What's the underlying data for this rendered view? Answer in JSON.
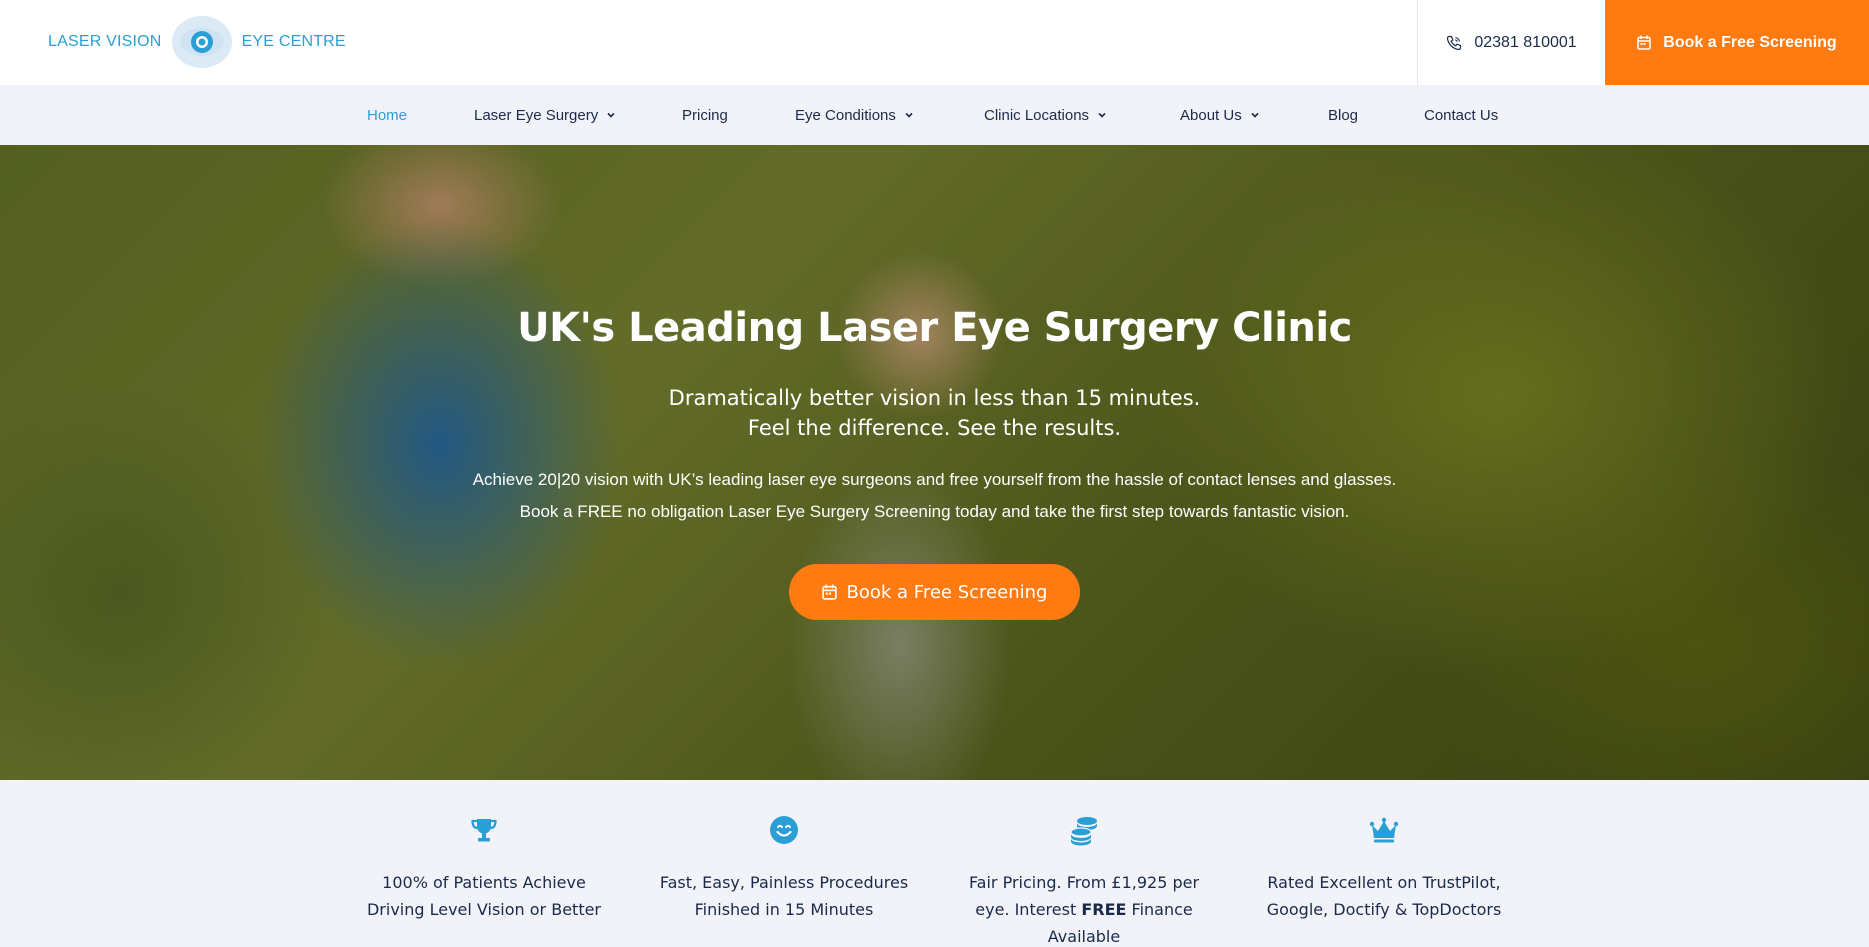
{
  "brand": {
    "name_left": "LASER VISION",
    "name_right": "EYE CENTRE",
    "color": "#2a9fd6"
  },
  "header": {
    "phone_icon": "phone-icon",
    "phone": "02381 810001",
    "cta_icon": "calendar-icon",
    "cta_label": "Book a Free Screening",
    "cta_color": "#ff7a11"
  },
  "nav": {
    "items": [
      {
        "label": "Home",
        "active": true,
        "dropdown": false
      },
      {
        "label": "Laser Eye Surgery",
        "active": false,
        "dropdown": true
      },
      {
        "label": "Pricing",
        "active": false,
        "dropdown": false
      },
      {
        "label": "Eye Conditions",
        "active": false,
        "dropdown": true
      },
      {
        "label": "Clinic Locations",
        "active": false,
        "dropdown": true
      },
      {
        "label": "About Us",
        "active": false,
        "dropdown": true
      },
      {
        "label": "Blog",
        "active": false,
        "dropdown": false
      },
      {
        "label": "Contact Us",
        "active": false,
        "dropdown": false
      }
    ]
  },
  "hero": {
    "title": "UK's Leading Laser Eye Surgery Clinic",
    "subtitle_line1": "Dramatically better vision in less than 15 minutes.",
    "subtitle_line2": "Feel the difference. See the results.",
    "body_line1": "Achieve 20|20 vision with UK’s leading laser eye surgeons and free yourself from the hassle of contact lenses and glasses.",
    "body_line2": "Book a FREE no obligation Laser Eye Surgery Screening today and take the first step towards fantastic vision.",
    "button_icon": "calendar-icon",
    "button_label": "Book a Free Screening"
  },
  "features": [
    {
      "icon": "trophy-icon",
      "line1": "100% of Patients Achieve",
      "line2": "Driving Level Vision or Better"
    },
    {
      "icon": "smile-icon",
      "line1": "Fast, Easy, Painless Procedures",
      "line2": "Finished in 15 Minutes"
    },
    {
      "icon": "coins-icon",
      "line1": "Fair Pricing. From £1,925 per",
      "line2_pre": "eye. Interest ",
      "line2_bold": "FREE",
      "line2_post": " Finance",
      "line3": "Available"
    },
    {
      "icon": "crown-icon",
      "line1": "Rated Excellent on TrustPilot,",
      "line2": "Google, Doctify & TopDoctors"
    }
  ]
}
